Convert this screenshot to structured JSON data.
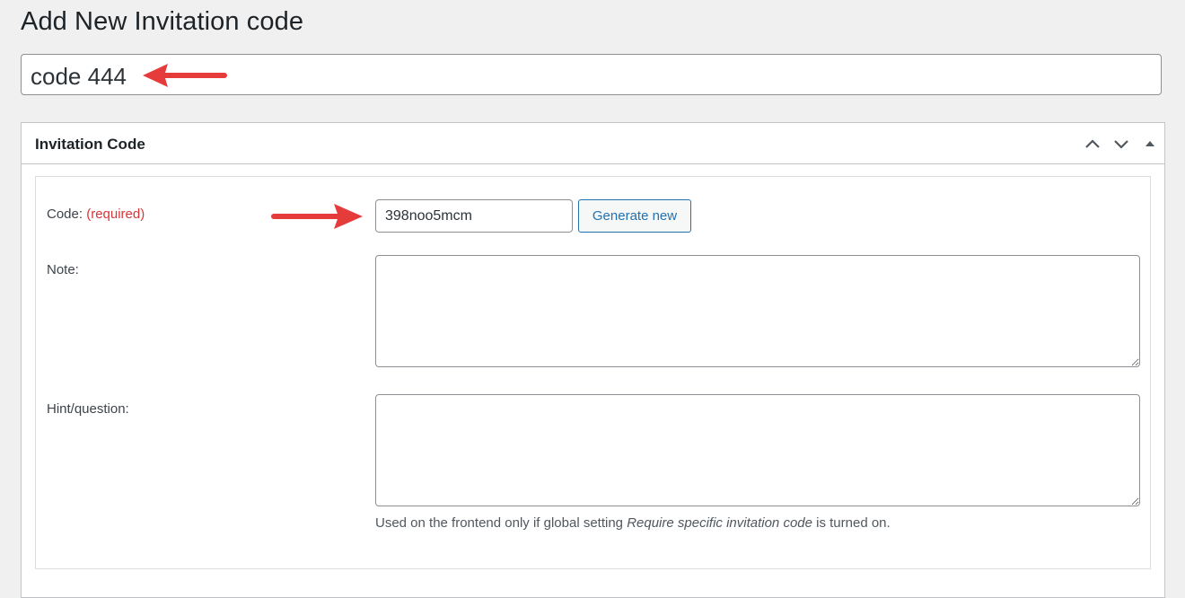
{
  "page": {
    "title": "Add New Invitation code"
  },
  "post_title": {
    "value": "code 444"
  },
  "metabox": {
    "title": "Invitation Code",
    "header_icons": [
      "chevron-up-icon",
      "chevron-down-icon",
      "caret-up-icon"
    ],
    "fields": {
      "code": {
        "label": "Code:",
        "required_label": "(required)",
        "value": "398noo5mcm",
        "generate_button": "Generate new"
      },
      "note": {
        "label": "Note:",
        "value": ""
      },
      "hint": {
        "label": "Hint/question:",
        "value": "",
        "description_pre": "Used on the frontend only if global setting ",
        "description_em": "Require specific invitation code",
        "description_post": " is turned on."
      }
    }
  },
  "colors": {
    "background": "#f0f0f1",
    "accent": "#2271b1",
    "required": "#d63638",
    "annotation_arrow": "#e63b3b"
  }
}
